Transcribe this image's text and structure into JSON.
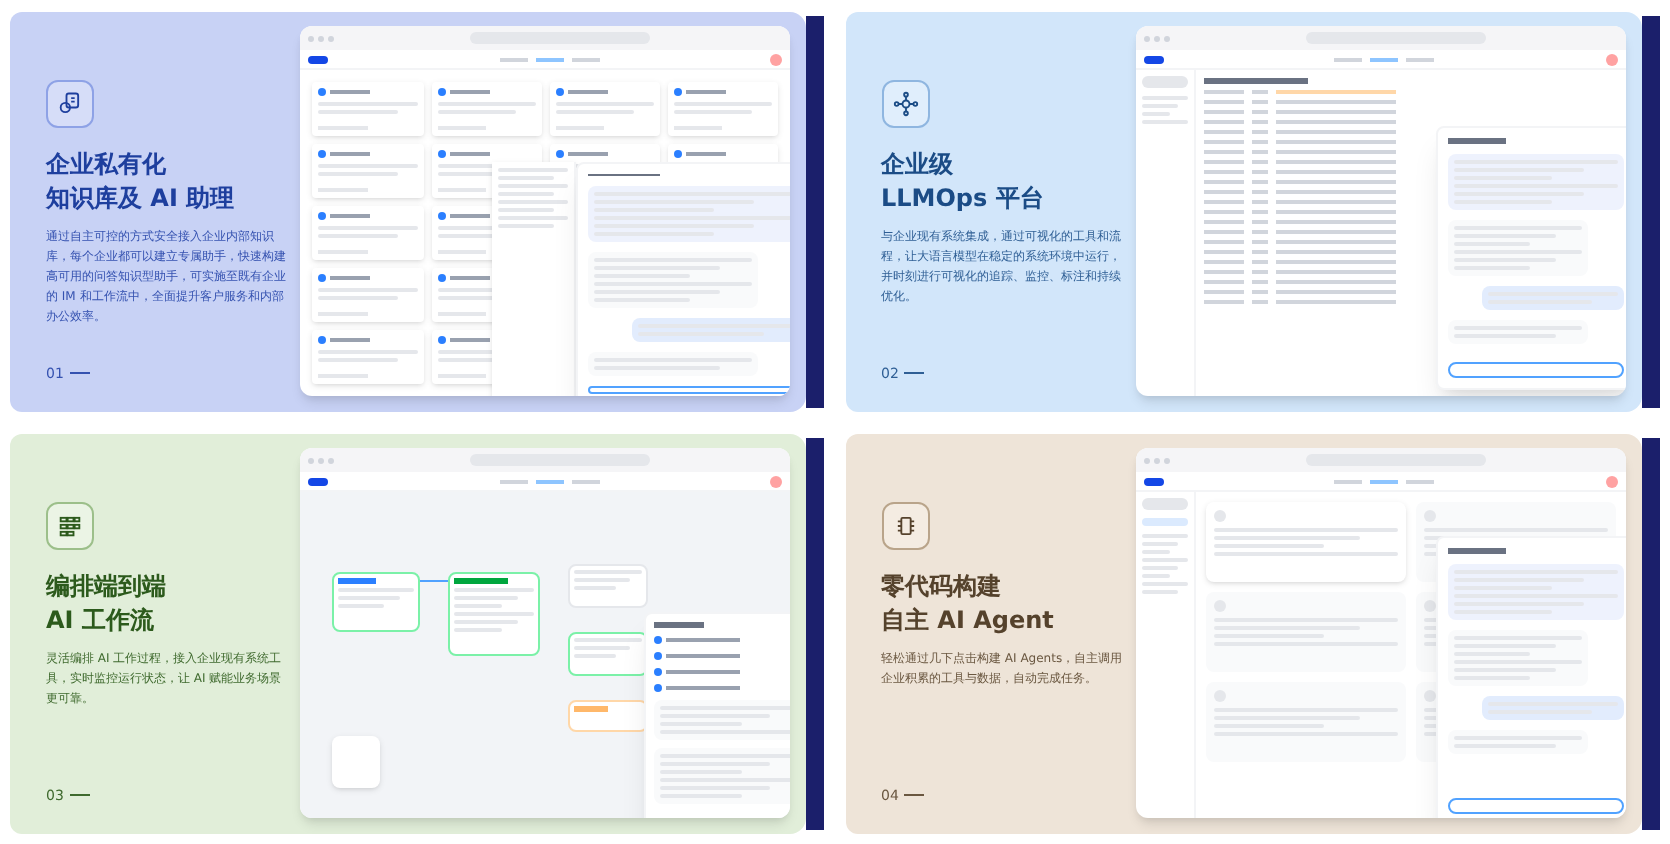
{
  "cards": [
    {
      "kind": "knowledge",
      "title_lines": [
        "企业私有化",
        "知识库及 AI 助理"
      ],
      "description": "通过自主可控的方式安全接入企业内部知识库，每个企业都可以建立专属助手，快速构建高可用的问答知识型助手，可实施至既有企业的 IM 和工作流中，全面提升客户服务和内部办公效率。",
      "number": "01"
    },
    {
      "kind": "llmops",
      "title_lines": [
        "企业级",
        "LLMOps 平台"
      ],
      "description": "与企业现有系统集成，通过可视化的工具和流程，让大语言模型在稳定的系统环境中运行，并时刻进行可视化的追踪、监控、标注和持续优化。",
      "number": "02"
    },
    {
      "kind": "workflow",
      "title_lines": [
        "编排端到端",
        "AI 工作流"
      ],
      "description": "灵活编排 AI 工作过程，接入企业现有系统工具，实时监控运行状态，让 AI 赋能业务场景更可靠。",
      "number": "03"
    },
    {
      "kind": "agent",
      "title_lines": [
        "零代码构建",
        "自主 AI Agent"
      ],
      "description": "轻松通过几下点击构建 AI Agents，自主调用企业积累的工具与数据，自动完成任务。",
      "number": "04"
    }
  ]
}
